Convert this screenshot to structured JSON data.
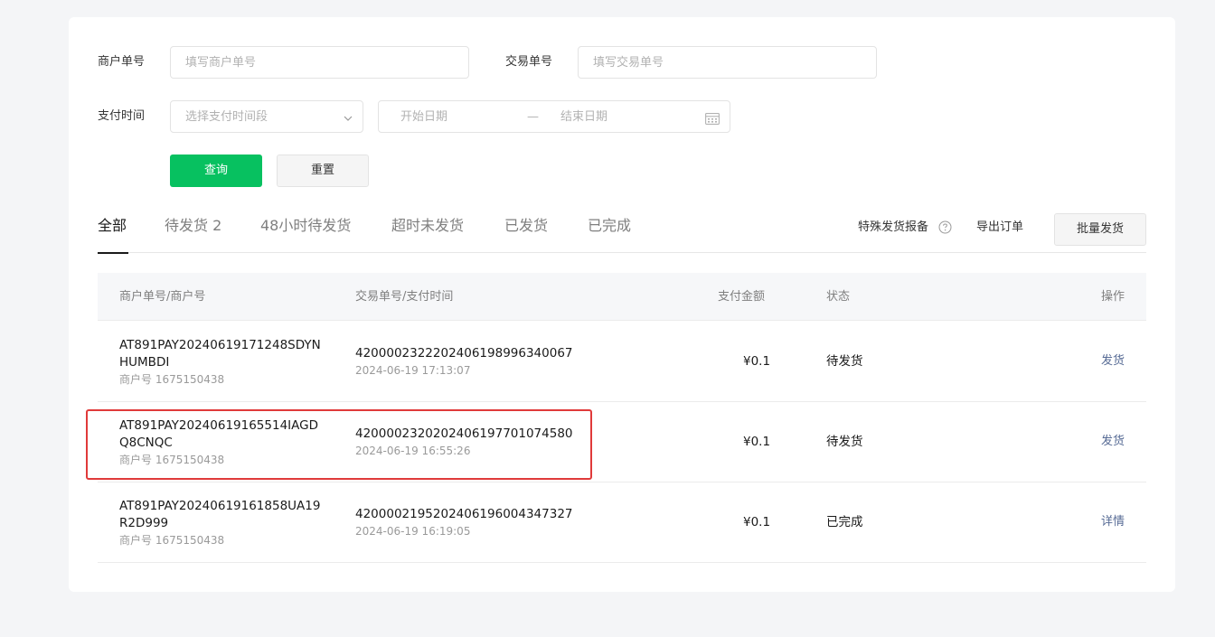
{
  "filters": {
    "merchant_order_label": "商户单号",
    "merchant_order_placeholder": "填写商户单号",
    "trade_order_label": "交易单号",
    "trade_order_placeholder": "填写交易单号",
    "pay_time_label": "支付时间",
    "pay_time_select_placeholder": "选择支付时间段",
    "start_date_placeholder": "开始日期",
    "date_separator": "—",
    "end_date_placeholder": "结束日期",
    "query_button": "查询",
    "reset_button": "重置"
  },
  "tabs": [
    {
      "label": "全部",
      "active": true
    },
    {
      "label": "待发货 2",
      "active": false
    },
    {
      "label": "48小时待发货",
      "active": false
    },
    {
      "label": "超时未发货",
      "active": false
    },
    {
      "label": "已发货",
      "active": false
    },
    {
      "label": "已完成",
      "active": false
    }
  ],
  "toolbar": {
    "special_report": "特殊发货报备",
    "export_orders": "导出订单",
    "batch_ship": "批量发货"
  },
  "table": {
    "headers": {
      "merchant": "商户单号/商户号",
      "trade": "交易单号/支付时间",
      "amount": "支付金额",
      "status": "状态",
      "action": "操作"
    },
    "rows": [
      {
        "order_line1": "AT891PAY20240619171248SDYN",
        "order_line2": "HUMBDI",
        "merchant_id": "商户号 1675150438",
        "trade_no": "4200002322202406198996340067",
        "pay_time": "2024-06-19 17:13:07",
        "amount": "¥0.1",
        "status": "待发货",
        "action": "发货"
      },
      {
        "order_line1": "AT891PAY20240619165514IAGD",
        "order_line2": "Q8CNQC",
        "merchant_id": "商户号 1675150438",
        "trade_no": "4200002320202406197701074580",
        "pay_time": "2024-06-19 16:55:26",
        "amount": "¥0.1",
        "status": "待发货",
        "action": "发货"
      },
      {
        "order_line1": "AT891PAY20240619161858UA19",
        "order_line2": "R2D999",
        "merchant_id": "商户号 1675150438",
        "trade_no": "4200002195202406196004347327",
        "pay_time": "2024-06-19 16:19:05",
        "amount": "¥0.1",
        "status": "已完成",
        "action": "详情"
      }
    ]
  },
  "colors": {
    "primary": "#07c160",
    "highlight_border": "#e03a3a",
    "link": "#576b95"
  },
  "icons": [
    "chevron-down-icon",
    "calendar-icon",
    "help-circle-icon"
  ]
}
